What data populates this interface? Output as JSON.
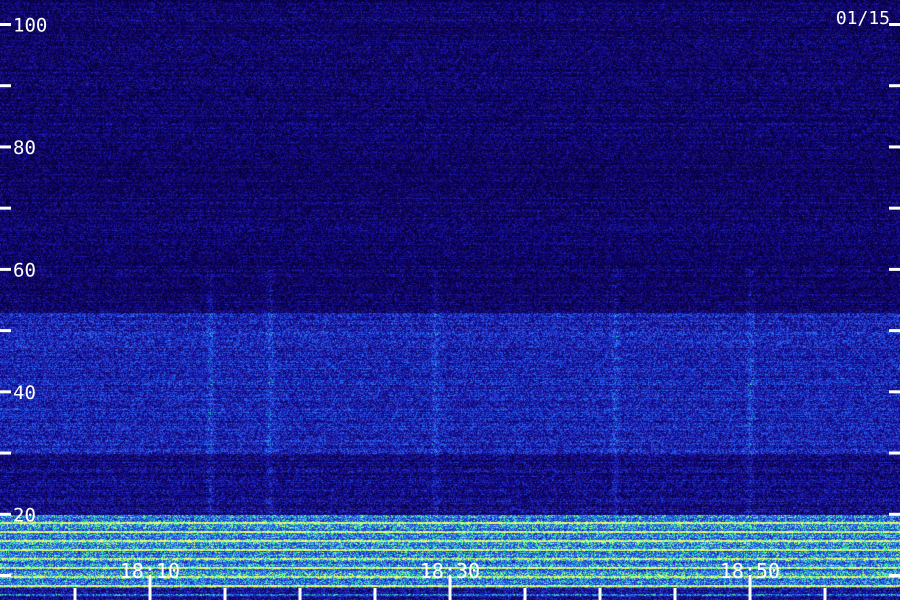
{
  "date_label": "01/15",
  "chart_data": {
    "type": "heatmap",
    "title": "",
    "xlabel": "",
    "ylabel": "",
    "grid": false,
    "legend": "none",
    "y_ticks": [
      100,
      80,
      60,
      40,
      20
    ],
    "y_tick_labels": [
      "100",
      "80",
      "60",
      "40",
      "20"
    ],
    "y_minor_ticks": [
      90,
      70,
      50,
      30,
      10
    ],
    "ylim": [
      6,
      104
    ],
    "x_ticks": [
      "18:10",
      "18:30",
      "18:50"
    ],
    "x_tick_minutes": [
      10,
      30,
      50
    ],
    "xlim_minutes": [
      0,
      60
    ],
    "x_tick_interval_minutes": 5,
    "bands": [
      {
        "y_min": 30,
        "y_max": 53,
        "intensity": 0.55
      },
      {
        "y_min": 8,
        "y_max": 20,
        "intensity": 0.95
      }
    ],
    "vertical_streaks_minutes": [
      14,
      18,
      29,
      41,
      50
    ],
    "colors": {
      "background": "#07003a",
      "low": "#1a10a0",
      "mid": "#2a5cff",
      "high": "#3bff9a",
      "peak": "#f4ff6a",
      "axis": "#ffffff"
    }
  }
}
